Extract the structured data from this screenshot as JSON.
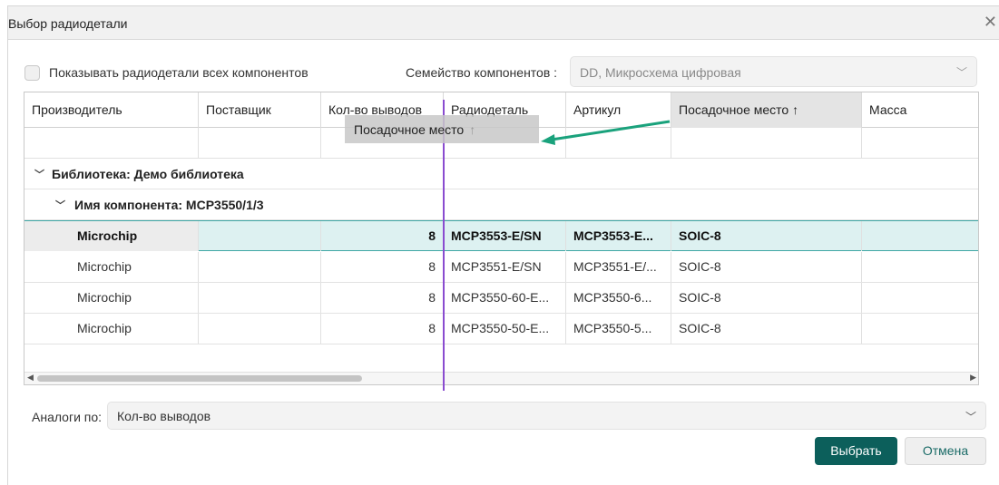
{
  "dialog": {
    "title": "Выбор радиодетали",
    "close_icon": "close-icon"
  },
  "filters": {
    "show_all_label": "Показывать радиодетали всех компонентов",
    "show_all_checked": false,
    "family_label": "Семейство компонентов :",
    "family_value": "DD, Микросхема цифровая"
  },
  "grid": {
    "columns": [
      "Производитель",
      "Поставщик",
      "Кол-во выводов",
      "Радиодеталь",
      "Артикул",
      "Посадочное место ↑",
      "Масса"
    ],
    "sorted_column": "Посадочное место",
    "groups": {
      "library": "Библиотека: Демо библиотека",
      "component": "Имя компонента: MCP3550/1/3"
    },
    "rows": [
      [
        "Microchip",
        "",
        "8",
        "MCP3553-E/SN",
        "MCP3553-E...",
        "SOIC-8",
        ""
      ],
      [
        "Microchip",
        "",
        "8",
        "MCP3551-E/SN",
        "MCP3551-E/...",
        "SOIC-8",
        ""
      ],
      [
        "Microchip",
        "",
        "8",
        "MCP3550-60-E...",
        "MCP3550-6...",
        "SOIC-8",
        ""
      ],
      [
        "Microchip",
        "",
        "8",
        "MCP3550-50-E...",
        "MCP3550-5...",
        "SOIC-8",
        ""
      ]
    ],
    "selected_row": 0
  },
  "drag_ghost": {
    "label": "Посадочное место",
    "icon": "arrow-up-icon"
  },
  "analogs": {
    "label": "Аналоги по:",
    "value": "Кол-во выводов"
  },
  "buttons": {
    "select": "Выбрать",
    "cancel": "Отмена"
  },
  "colors": {
    "primary": "#0c5f5b",
    "selection": "#ddf1f1",
    "selection_border": "#3fa7a5",
    "drop_marker": "#8a4cd0",
    "annotation_arrow": "#1aa27c"
  }
}
